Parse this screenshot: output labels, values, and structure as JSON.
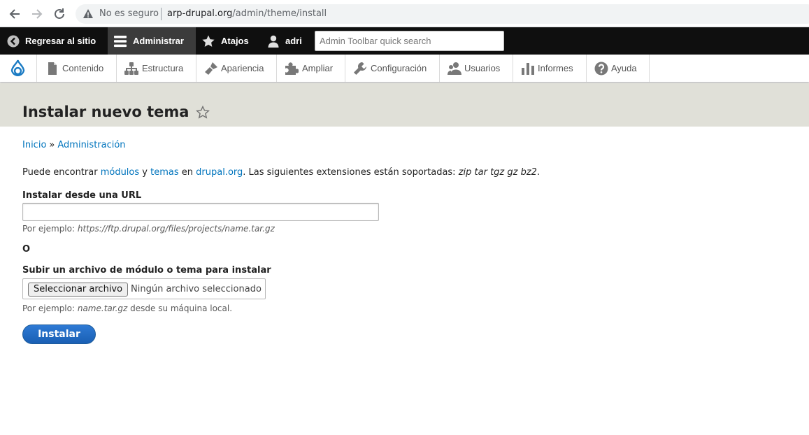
{
  "browser": {
    "status_text": "No es seguro",
    "url_host": "arp-drupal.org",
    "url_path": "/admin/theme/install"
  },
  "toolbar": {
    "back_to_site": "Regresar al sitio",
    "manage": "Administrar",
    "shortcuts": "Atajos",
    "user": "adri",
    "search_placeholder": "Admin Toolbar quick search"
  },
  "tray": {
    "items": [
      {
        "label": "Contenido",
        "icon": "file-icon"
      },
      {
        "label": "Estructura",
        "icon": "sitemap-icon"
      },
      {
        "label": "Apariencia",
        "icon": "paintbrush-icon"
      },
      {
        "label": "Ampliar",
        "icon": "puzzle-icon"
      },
      {
        "label": "Configuración",
        "icon": "wrench-icon"
      },
      {
        "label": "Usuarios",
        "icon": "people-icon"
      },
      {
        "label": "Informes",
        "icon": "bar-chart-icon"
      },
      {
        "label": "Ayuda",
        "icon": "help-icon"
      }
    ]
  },
  "page": {
    "title": "Instalar nuevo tema",
    "breadcrumb": {
      "home": "Inicio",
      "separator": "»",
      "admin": "Administración"
    },
    "intro": {
      "prefix": "Puede encontrar ",
      "modules_link": "módulos",
      "and": " y ",
      "themes_link": "temas",
      "in": " en ",
      "drupal_link": "drupal.org",
      "suffix": ". Las siguientes extensiones están soportadas: ",
      "extensions": "zip tar tgz gz bz2",
      "end": "."
    },
    "url_field": {
      "label": "Instalar desde una URL",
      "value": "",
      "desc_prefix": "Por ejemplo: ",
      "desc_example": "https://ftp.drupal.org/files/projects/name.tar.gz"
    },
    "or_label": "O",
    "upload_field": {
      "label": "Subir un archivo de módulo o tema para instalar",
      "button": "Seleccionar archivo",
      "status": "Ningún archivo seleccionado",
      "desc_prefix": "Por ejemplo: ",
      "desc_example": "name.tar.gz",
      "desc_suffix": " desde su máquina local."
    },
    "submit_label": "Instalar"
  },
  "colors": {
    "link": "#0074bd",
    "toolbar_black": "#0f0f0f",
    "header_bg": "#e0e0d8",
    "button_primary": "#1a5fb4"
  }
}
